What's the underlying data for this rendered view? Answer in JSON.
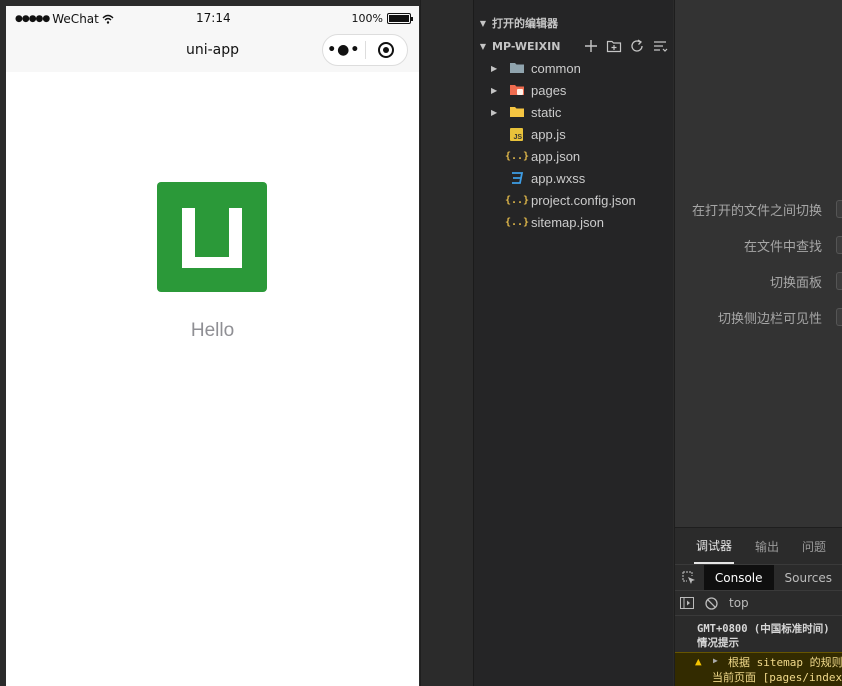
{
  "simulator": {
    "status_bar": {
      "carrier": "WeChat",
      "time": "17:14",
      "battery": "100%"
    },
    "nav": {
      "title": "uni-app"
    },
    "content": {
      "greeting": "Hello"
    }
  },
  "explorer": {
    "open_editors_label": "打开的编辑器",
    "project_label": "MP-WEIXIN",
    "items": [
      {
        "label": "common",
        "kind": "folder",
        "icon": "folder-icon"
      },
      {
        "label": "pages",
        "kind": "folder",
        "icon": "pages-folder-icon"
      },
      {
        "label": "static",
        "kind": "folder",
        "icon": "static-folder-icon"
      },
      {
        "label": "app.js",
        "kind": "file",
        "icon": "js-file-icon"
      },
      {
        "label": "app.json",
        "kind": "file",
        "icon": "json-file-icon"
      },
      {
        "label": "app.wxss",
        "kind": "file",
        "icon": "css-file-icon"
      },
      {
        "label": "project.config.json",
        "kind": "file",
        "icon": "json-file-icon"
      },
      {
        "label": "sitemap.json",
        "kind": "file",
        "icon": "json-file-icon"
      }
    ]
  },
  "shortcuts": [
    {
      "label": "在打开的文件之间切换"
    },
    {
      "label": "在文件中查找"
    },
    {
      "label": "切换面板"
    },
    {
      "label": "切换侧边栏可见性"
    }
  ],
  "debugger": {
    "tabs": [
      "调试器",
      "输出",
      "问题"
    ],
    "console_tabs": [
      "Console",
      "Sources"
    ],
    "context": "top",
    "log": {
      "line1": "GMT+0800 (中国标准时间)",
      "line2": "情况提示",
      "warn_line1": "根据 sitemap 的规则",
      "warn_line2": "当前页面 [pages/index"
    }
  },
  "colors": {
    "logo_green": "#2b9939",
    "accent_warn": "#f5c400"
  }
}
